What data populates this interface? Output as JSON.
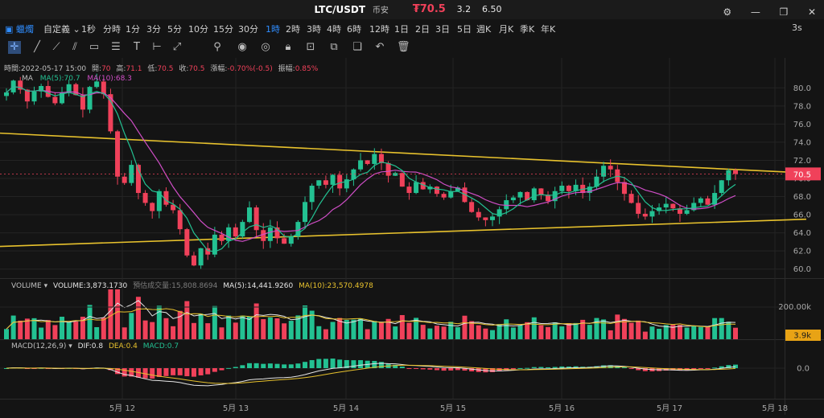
{
  "header": {
    "pair": "LTC/USDT",
    "exchange": "币安",
    "price": "₮70.5",
    "stat1": "3.2",
    "stat2": "6.50",
    "buttons": [
      "gear-icon",
      "minimize-icon",
      "restore-icon",
      "close-icon"
    ]
  },
  "toolbar": {
    "chart_type": "蠟燭",
    "custom_label": "自定義",
    "timeframes": [
      "1秒",
      "分時",
      "1分",
      "3分",
      "5分",
      "10分",
      "15分",
      "30分",
      "1時",
      "2時",
      "3時",
      "4時",
      "6時",
      "12時",
      "1日",
      "2日",
      "3日",
      "5日",
      "週K",
      "月K",
      "季K",
      "年K"
    ],
    "active_timeframe": "1時",
    "refresh": "3s",
    "tools": [
      "crosshair-icon",
      "line-icon",
      "ray-icon",
      "parallel-line-icon",
      "rectangle-icon",
      "horizontal-line-icon",
      "text-icon",
      "magnet-icon",
      "eye-icon",
      "lock-icon",
      "copy-icon",
      "clone-icon",
      "undo-icon",
      "delete-icon"
    ]
  },
  "colors": {
    "up": "#23c192",
    "down": "#f0415a",
    "accent": "#2f8dff",
    "trend": "#e8c22d"
  },
  "info": {
    "time_label": "時間:",
    "time": "2022-05-17 15:00",
    "open_label": "開:",
    "open": "70",
    "high_label": "高:",
    "high": "71.1",
    "low_label": "低:",
    "low": "70.5",
    "close_label": "收:",
    "close": "70.5",
    "change_label": "漲幅:",
    "change": "-0.70%(-0.5)",
    "amp_label": "振幅:",
    "amp": "0.85%"
  },
  "ma_legend": {
    "name": "MA",
    "ma5": "MA(5):70.7",
    "ma10": "MA(10):68.3"
  },
  "vol_legend": {
    "name": "VOLUME",
    "vol": "VOLUME:3,873.1730",
    "est": "預估成交量:15,808.8694",
    "ma5": "MA(5):14,441.9260",
    "ma10": "MA(10):23,570.4978"
  },
  "macd_legend": {
    "name": "MACD(12,26,9)",
    "dif": "DIF:0.8",
    "dea": "DEA:0.4",
    "macd": "MACD:0.7"
  },
  "chart_data": {
    "type": "candlestick",
    "price_axis": [
      "80.0",
      "78.0",
      "76.0",
      "74.0",
      "72.0",
      "70.0",
      "68.0",
      "66.0",
      "64.0",
      "62.0",
      "60.0"
    ],
    "price_range": [
      59.0,
      81.0
    ],
    "last_price": "70.5",
    "vol_axis": "200.00k",
    "vol_last": "3.9k",
    "macd_axis": "0.0",
    "dates": [
      "5月 12",
      "5月 13",
      "5月 14",
      "5月 15",
      "5月 16",
      "5月 17",
      "5月 18"
    ],
    "trendline_upper": {
      "from": [
        0,
        75.0
      ],
      "to": [
        1.0,
        70.6
      ]
    },
    "trendline_lower": {
      "from": [
        0,
        62.5
      ],
      "to": [
        1.0,
        65.5
      ]
    },
    "price_path": [
      79.5,
      80.8,
      79.8,
      78.5,
      79.6,
      80.2,
      79.0,
      78.3,
      79.5,
      80.4,
      79.2,
      77.6,
      80.1,
      80.7,
      79.3,
      75.2,
      70.2,
      69.5,
      71.5,
      68.4,
      67.3,
      66.4,
      68.6,
      67.1,
      66.5,
      64.4,
      61.5,
      60.4,
      62.3,
      61.6,
      63.8,
      63.1,
      64.6,
      63.6,
      65.2,
      66.8,
      64.3,
      63.1,
      64.6,
      63.4,
      62.8,
      63.6,
      65.2,
      67.4,
      69.2,
      69.8,
      69.3,
      70.4,
      68.9,
      69.9,
      71.0,
      72.0,
      71.6,
      72.7,
      71.7,
      70.3,
      70.6,
      69.1,
      68.4,
      69.6,
      68.8,
      69.1,
      68.3,
      67.9,
      68.6,
      69.0,
      67.4,
      66.3,
      65.7,
      65.4,
      65.8,
      66.6,
      67.6,
      67.9,
      68.5,
      67.6,
      68.9,
      68.2,
      67.5,
      68.6,
      69.2,
      68.6,
      69.3,
      68.4,
      69.1,
      70.2,
      71.4,
      71.0,
      69.6,
      68.3,
      67.3,
      66.1,
      65.8,
      66.4,
      66.8,
      67.2,
      66.7,
      66.1,
      66.5,
      67.3,
      67.8,
      67.1,
      68.4,
      69.8,
      70.9,
      70.5
    ]
  }
}
